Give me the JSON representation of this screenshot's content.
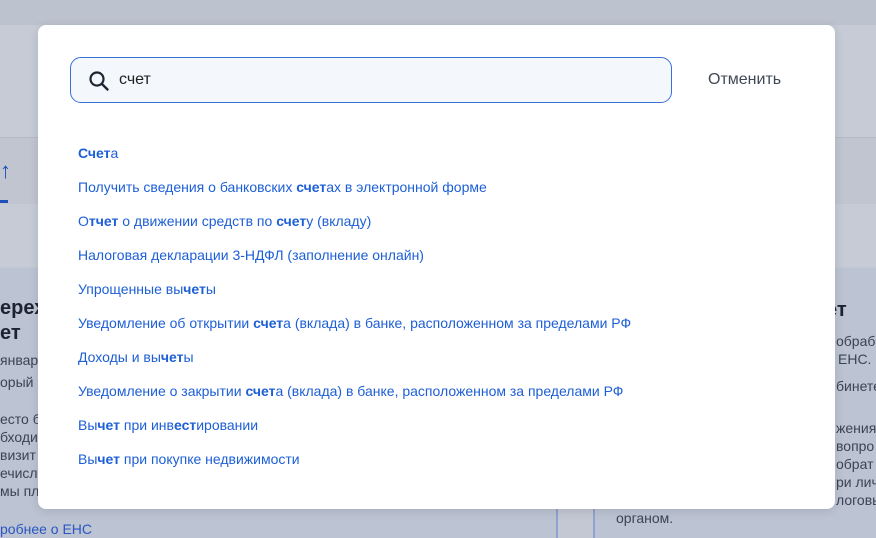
{
  "background": {
    "left_title_lines": [
      "ерехо",
      "ет"
    ],
    "left_text_lines": [
      "январ",
      "орый п",
      "",
      "есто б",
      "бходи",
      "визит",
      "ечисл",
      "мы пл"
    ],
    "left_link": "робнее о ЕНС",
    "right_title": "ет",
    "right_text_lines": [
      "обрабо",
      "ЕНС.",
      "бинете",
      "",
      "жения",
      "вопро",
      "обрат",
      "ри лич",
      "логовы",
      "органом."
    ]
  },
  "search": {
    "value": "счет",
    "icon": "search-icon"
  },
  "cancel_label": "Отменить",
  "results": [
    {
      "segments": [
        {
          "text": "Счет",
          "bold": true
        },
        {
          "text": "а",
          "bold": false
        }
      ]
    },
    {
      "segments": [
        {
          "text": "Получить сведения о банковских ",
          "bold": false
        },
        {
          "text": "счет",
          "bold": true
        },
        {
          "text": "ах в электронной форме",
          "bold": false
        }
      ]
    },
    {
      "segments": [
        {
          "text": "О",
          "bold": false
        },
        {
          "text": "тчет",
          "bold": true
        },
        {
          "text": " о движении средств по ",
          "bold": false
        },
        {
          "text": "счет",
          "bold": true
        },
        {
          "text": "у (вкладу)",
          "bold": false
        }
      ]
    },
    {
      "segments": [
        {
          "text": "Налоговая декларации 3-НДФЛ (заполнение онлайн)",
          "bold": false
        }
      ]
    },
    {
      "segments": [
        {
          "text": "Упрощенные вы",
          "bold": false
        },
        {
          "text": "чет",
          "bold": true
        },
        {
          "text": "ы",
          "bold": false
        }
      ]
    },
    {
      "segments": [
        {
          "text": "Уведомление об открытии ",
          "bold": false
        },
        {
          "text": "счет",
          "bold": true
        },
        {
          "text": "а (вклада) в банке, расположенном за пределами РФ",
          "bold": false
        }
      ]
    },
    {
      "segments": [
        {
          "text": "Доходы и вы",
          "bold": false
        },
        {
          "text": "чет",
          "bold": true
        },
        {
          "text": "ы",
          "bold": false
        }
      ]
    },
    {
      "segments": [
        {
          "text": "Уведомление о закрытии ",
          "bold": false
        },
        {
          "text": "счет",
          "bold": true
        },
        {
          "text": "а (вклада) в банке, расположенном за пределами РФ",
          "bold": false
        }
      ]
    },
    {
      "segments": [
        {
          "text": "Вы",
          "bold": false
        },
        {
          "text": "чет",
          "bold": true
        },
        {
          "text": " при инв",
          "bold": false
        },
        {
          "text": "ест",
          "bold": true
        },
        {
          "text": "ировании",
          "bold": false
        }
      ]
    },
    {
      "segments": [
        {
          "text": "Вы",
          "bold": false
        },
        {
          "text": "чет",
          "bold": true
        },
        {
          "text": " при покупке недвижимости",
          "bold": false
        }
      ]
    }
  ],
  "colors": {
    "link": "#1d5fd6",
    "search_border": "#3a6fd6"
  }
}
